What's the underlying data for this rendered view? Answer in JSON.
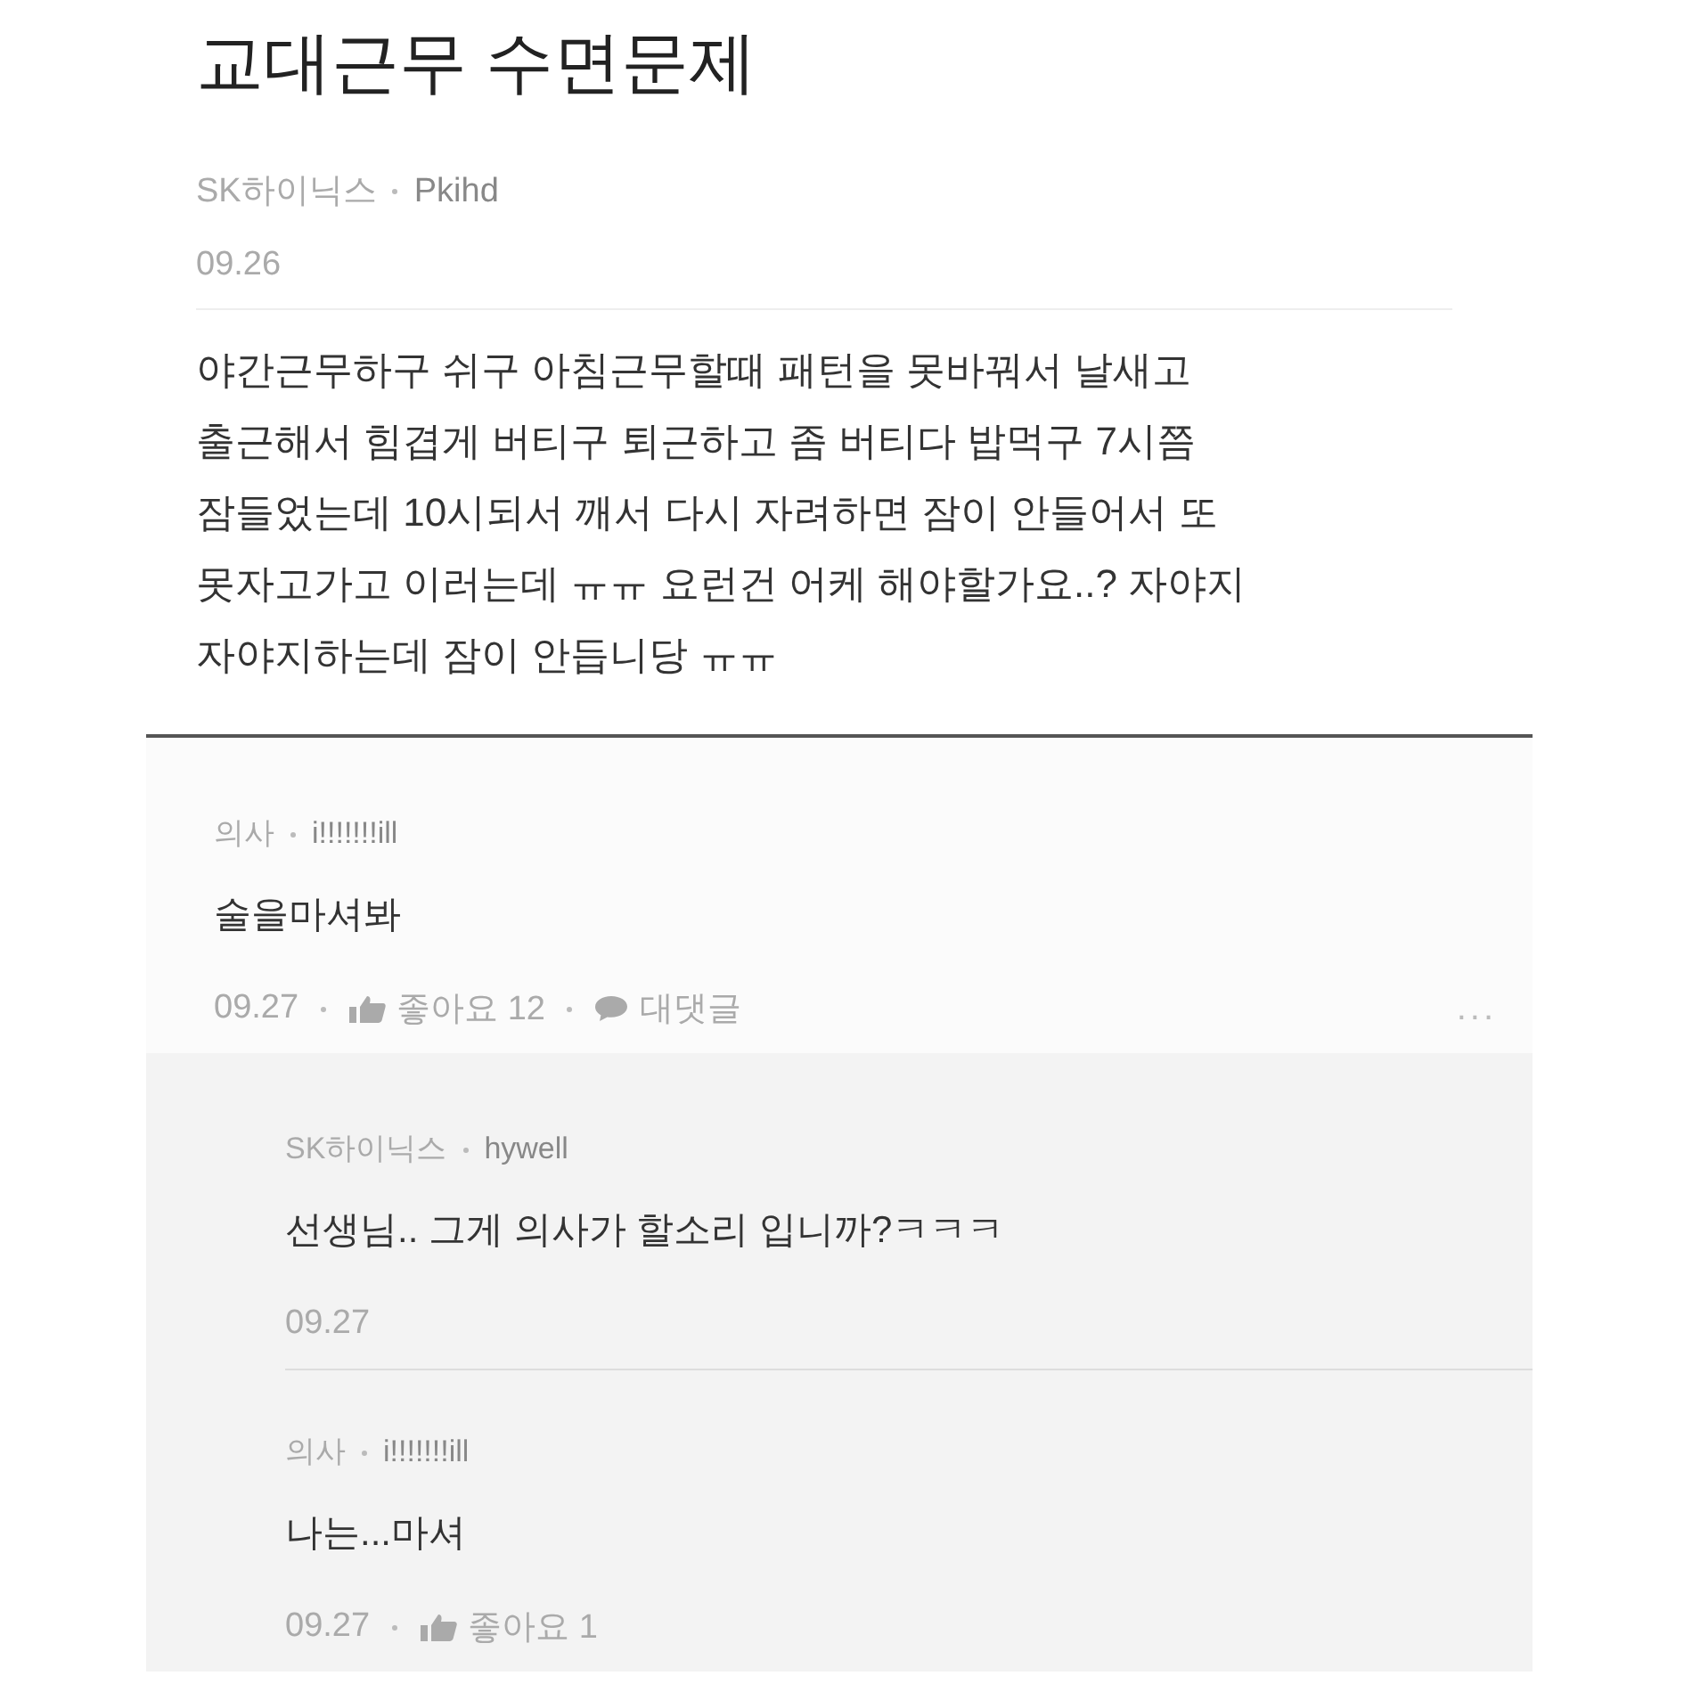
{
  "post": {
    "title": "교대근무 수면문제",
    "company": "SK하이닉스",
    "author": "Pkihd",
    "date": "09.26",
    "body_lines": [
      "야간근무하구 쉬구 아침근무할때 패턴을 못바꿔서 날새고",
      "출근해서 힘겹게 버티구 퇴근하고 좀 버티다 밥먹구 7시쯤",
      "잠들었는데 10시되서 깨서 다시 자려하면 잠이 안들어서 또",
      "못자고가고 이러는데 ㅠㅠ 요런건 어케 해야할가요..? 자야지",
      "자야지하는데 잠이 안듭니당 ㅠㅠ"
    ]
  },
  "comments": [
    {
      "kind": "comment",
      "company": "의사",
      "author": "i!!!!!!!ill",
      "text": "술을마셔봐",
      "date": "09.27",
      "likes": "좋아요 12",
      "reply": "대댓글",
      "more": "..."
    },
    {
      "kind": "reply",
      "company": "SK하이닉스",
      "author": "hywell",
      "text": "선생님.. 그게 의사가 할소리 입니까?ㅋㅋㅋ",
      "date": "09.27"
    },
    {
      "kind": "reply",
      "company": "의사",
      "author": "i!!!!!!!ill",
      "text": "나는...마셔",
      "date": "09.27",
      "likes": "좋아요 1"
    }
  ]
}
